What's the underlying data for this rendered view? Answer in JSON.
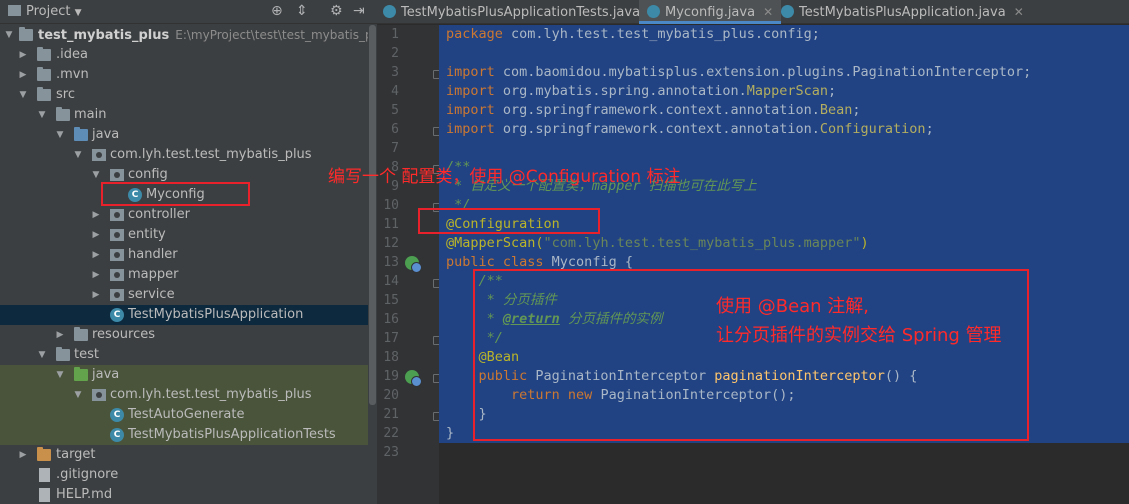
{
  "project_panel": {
    "title": "Project",
    "tree": [
      {
        "label": "test_mybatis_plus",
        "path": "E:\\myProject\\test\\test_mybatis_plus"
      },
      {
        "label": ".idea"
      },
      {
        "label": ".mvn"
      },
      {
        "label": "src"
      },
      {
        "label": "main"
      },
      {
        "label": "java"
      },
      {
        "label": "com.lyh.test.test_mybatis_plus"
      },
      {
        "label": "config"
      },
      {
        "label": "Myconfig"
      },
      {
        "label": "controller"
      },
      {
        "label": "entity"
      },
      {
        "label": "handler"
      },
      {
        "label": "mapper"
      },
      {
        "label": "service"
      },
      {
        "label": "TestMybatisPlusApplication"
      },
      {
        "label": "resources"
      },
      {
        "label": "test"
      },
      {
        "label": "java"
      },
      {
        "label": "com.lyh.test.test_mybatis_plus"
      },
      {
        "label": "TestAutoGenerate"
      },
      {
        "label": "TestMybatisPlusApplicationTests"
      },
      {
        "label": "target"
      },
      {
        "label": ".gitignore"
      },
      {
        "label": "HELP.md"
      }
    ]
  },
  "tabs": [
    {
      "label": "TestMybatisPlusApplicationTests.java"
    },
    {
      "label": "Myconfig.java"
    },
    {
      "label": "TestMybatisPlusApplication.java"
    }
  ],
  "line_numbers": [
    "1",
    "2",
    "3",
    "4",
    "5",
    "6",
    "7",
    "8",
    "9",
    "10",
    "11",
    "12",
    "13",
    "14",
    "15",
    "16",
    "17",
    "18",
    "19",
    "20",
    "21",
    "22",
    "23"
  ],
  "code": {
    "l1_kw": "package",
    "l1_rest": " com.lyh.test.test_mybatis_plus.config;",
    "l3_kw": "import",
    "l3_rest": " com.baomidou.mybatisplus.extension.plugins.PaginationInterceptor;",
    "l4_kw": "import",
    "l4_rest": " org.mybatis.spring.annotation.",
    "l4_hl": "MapperScan",
    "l4_end": ";",
    "l5_kw": "import",
    "l5_rest": " org.springframework.context.annotation.",
    "l5_hl": "Bean",
    "l5_end": ";",
    "l6_kw": "import",
    "l6_rest": " org.springframework.context.annotation.",
    "l6_hl": "Configuration",
    "l6_end": ";",
    "l8": "/**",
    "l9": " * 自定义一个配置类，mapper 扫描也可在此写上",
    "l10": " */",
    "l11": "@Configuration",
    "l12_ann": "@MapperScan(",
    "l12_str": "\"com.lyh.test.test_mybatis_plus.mapper\"",
    "l12_end": ")",
    "l13_kw": "public class",
    "l13_rest": " Myconfig {",
    "l14": "    /**",
    "l15": "     * 分页插件",
    "l16_pre": "     * ",
    "l16_tag": "@return",
    "l16_post": " 分页插件的实例",
    "l17": "     */",
    "l18": "    @Bean",
    "l19_kw": "    public",
    "l19_rest": " PaginationInterceptor ",
    "l19_fn": "paginationInterceptor",
    "l19_end": "() {",
    "l20_kw": "        return new",
    "l20_rest": " PaginationInterceptor();",
    "l21": "    }",
    "l22": "}"
  },
  "annotations": {
    "note1": "编写一个 配置类，使用 @Configuration 标注",
    "note2_line1": "使用 @Bean 注解,",
    "note2_line2": "让分页插件的实例交给 Spring 管理"
  },
  "colors": {
    "annotation_red": "#e8212b",
    "selection_blue": "#214283"
  }
}
